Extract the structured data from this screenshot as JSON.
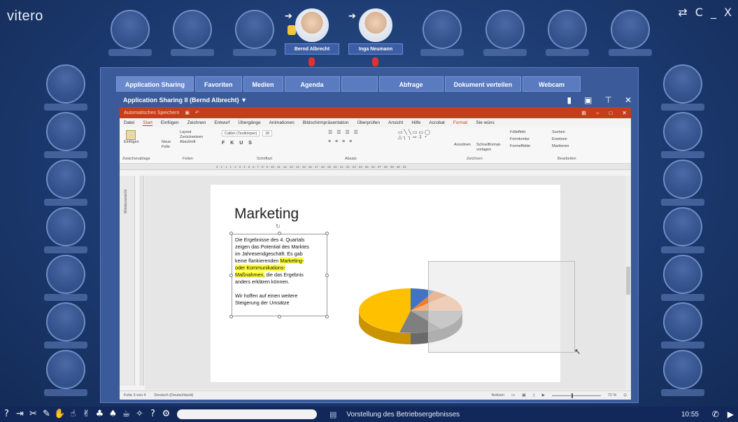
{
  "app": {
    "logo": "vitero",
    "window_controls": "⇄ C _ X"
  },
  "participants": [
    {
      "name": "Bernd Albrecht"
    },
    {
      "name": "Inga Neumann"
    }
  ],
  "tabs": [
    {
      "label": "Application Sharing"
    },
    {
      "label": "Favoriten"
    },
    {
      "label": "Medien"
    },
    {
      "label": "Agenda"
    },
    {
      "label": ""
    },
    {
      "label": "Abfrage"
    },
    {
      "label": "Dokument verteilen"
    },
    {
      "label": "Webcam"
    }
  ],
  "sharing": {
    "title": "Application Sharing II (Bernd Albrecht) ▼"
  },
  "powerpoint": {
    "titlebar": {
      "autosave": "Automatisches Speichern",
      "controls": [
        "⊞",
        "–",
        "□",
        "✕"
      ]
    },
    "menu": [
      "Datei",
      "Start",
      "Einfügen",
      "Zeichnen",
      "Entwurf",
      "Übergänge",
      "Animationen",
      "Bildschirmpräsentation",
      "Überprüfen",
      "Ansicht",
      "Hilfe",
      "Acrobat",
      "Format",
      "Sie wüns"
    ],
    "ribbon_groups": [
      "Zwischenablage",
      "Folien",
      "Schriftart",
      "Absatz",
      "Zeichnen",
      "Bearbeiten"
    ],
    "ribbon_items": {
      "paste": "Einfügen",
      "new_slide": "Neue Folie",
      "layout": "Layout",
      "reset": "Zurücksetzen",
      "section": "Abschnitt",
      "font": "Calibri (Textkörper)",
      "size": "18",
      "arrange": "Anordnen",
      "quick_styles": "Schnellformat-vorlagen",
      "fill": "Fülleffekt",
      "outline": "Formkontur",
      "effects": "Formeffekte",
      "find": "Suchen",
      "replace": "Ersetzen",
      "select": "Markieren"
    },
    "ruler_text": "2 · 1 · 1 · 1 · 2 · 3 · 4 · 5 · 6 · 7 · 8 · 9 · 10 · 11 · 12 · 13 · 14 · 15 · 16 · 17 · 18 · 19 · 20 · 21 · 22 · 23 · 24 · 25 · 26 · 27 · 28 · 29 · 30 · 31",
    "sidebar_label": "Miniaturansicht",
    "slide": {
      "title": "Marketing",
      "body_lines": [
        "Die Ergebnisse des 4. Quartals",
        "zeigen das Potential des Marktes",
        "im Jahresendgeschäft. Es gab"
      ],
      "line4_plain": "keine flankierenden ",
      "line4_hl": "Marketing-",
      "line5_hl": "oder Kommunikations-",
      "line6_hl": "Maßnahmen,",
      "line6_plain": " die das Ergebnis",
      "line7": "anders erklären können.",
      "closing_lines": [
        "Wir hoffen auf einen weitere",
        "Steigerung der Umsätze"
      ]
    },
    "pie_colors": [
      "#4472c4",
      "#ed7d31",
      "#f4b183",
      "#a5a5a5",
      "#7f7f7f",
      "#ffc000"
    ],
    "status": {
      "slide": "Folie 3 von 4",
      "language": "Deutsch (Deutschland)",
      "notes": "Notizen",
      "zoom": "72 %"
    }
  },
  "bottom": {
    "agenda_item": "Vorstellung des Betriebsergebnisses",
    "time": "10:55"
  }
}
